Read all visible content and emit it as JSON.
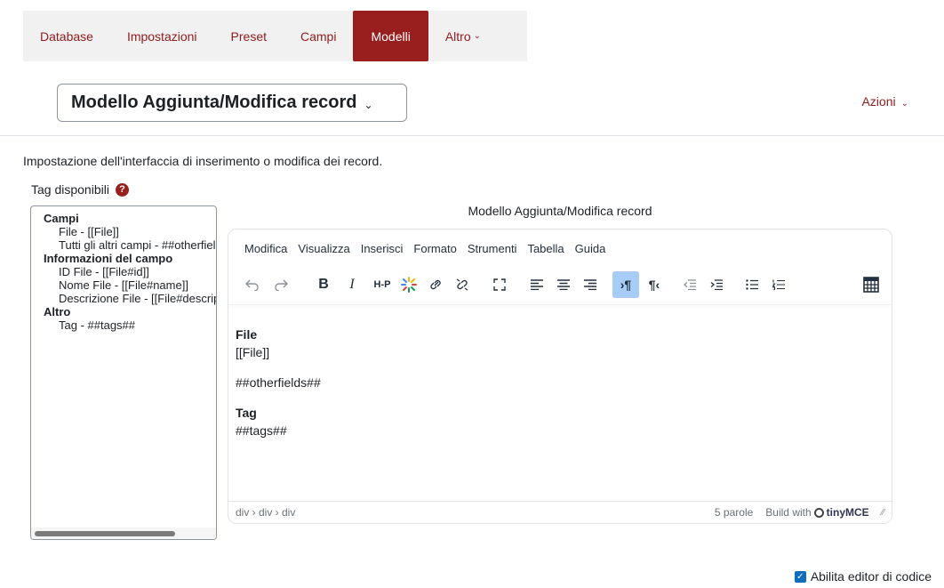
{
  "tabs": [
    {
      "label": "Database",
      "active": false
    },
    {
      "label": "Impostazioni",
      "active": false
    },
    {
      "label": "Preset",
      "active": false
    },
    {
      "label": "Campi",
      "active": false
    },
    {
      "label": "Modelli",
      "active": true
    },
    {
      "label": "Altro",
      "active": false
    }
  ],
  "template_selector": {
    "label": "Modello Aggiunta/Modifica record"
  },
  "actions_menu": {
    "label": "Azioni"
  },
  "description": "Impostazione dell'interfaccia di inserimento o modifica dei record.",
  "tags_label": "Tag disponibili",
  "help_icon_glyph": "?",
  "tag_list": {
    "groups": [
      {
        "label": "Campi",
        "items": [
          "File - [[File]]",
          "Tutti gli altri campi - ##otherfields##"
        ]
      },
      {
        "label": "Informazioni del campo",
        "items": [
          "ID File - [[File#id]]",
          "Nome File - [[File#name]]",
          "Descrizione File - [[File#description]]"
        ]
      },
      {
        "label": "Altro",
        "items": [
          "Tag - ##tags##"
        ]
      }
    ]
  },
  "editor": {
    "title": "Modello Aggiunta/Modifica record",
    "menu": [
      "Modifica",
      "Visualizza",
      "Inserisci",
      "Formato",
      "Strumenti",
      "Tabella",
      "Guida"
    ],
    "toolbar_icons": [
      "undo-icon",
      "redo-icon",
      "bold-icon",
      "italic-icon",
      "h5p-icon",
      "media-icon",
      "link-icon",
      "unlink-icon",
      "fullscreen-icon",
      "align-left-icon",
      "align-center-icon",
      "align-right-icon",
      "ltr-icon",
      "rtl-icon",
      "outdent-icon",
      "indent-icon",
      "bullet-list-icon",
      "numbered-list-icon",
      "calculator-icon"
    ],
    "toolbar_text": {
      "bold": "B",
      "italic": "I",
      "h5p": "H-P"
    },
    "content": {
      "h1": "File",
      "p1": "[[File]]",
      "p2": "##otherfields##",
      "h2": "Tag",
      "p3": "##tags##"
    },
    "status_path": "div › div › div",
    "word_count": "5 parole",
    "brand": "Build with",
    "brand_name": "tinyMCE"
  },
  "code_editor": {
    "label": "Abilita editor di codice",
    "checked": true
  },
  "colors": {
    "brand": "#991f1f",
    "link": "#8f1b1c",
    "checkbox": "#0f6cbf",
    "active_tool": "#a6ccf7"
  }
}
